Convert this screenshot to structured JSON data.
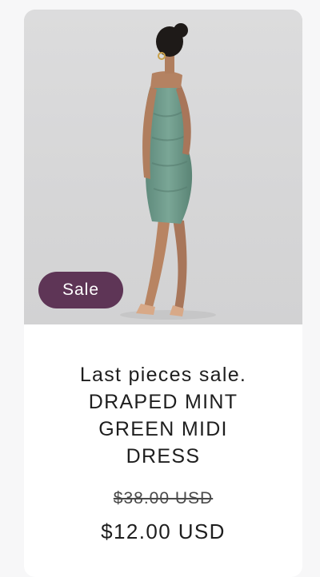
{
  "product": {
    "badge": "Sale",
    "title_line1": "Last pieces sale.",
    "title_line2": "DRAPED MINT",
    "title_line3": "GREEN MIDI",
    "title_line4": "DRESS",
    "price_original": "$38.00 USD",
    "price_sale": "$12.00 USD"
  },
  "colors": {
    "badge_bg": "#5e3556",
    "dress": "#6f9b8c",
    "photo_bg": "#d9d9da"
  }
}
